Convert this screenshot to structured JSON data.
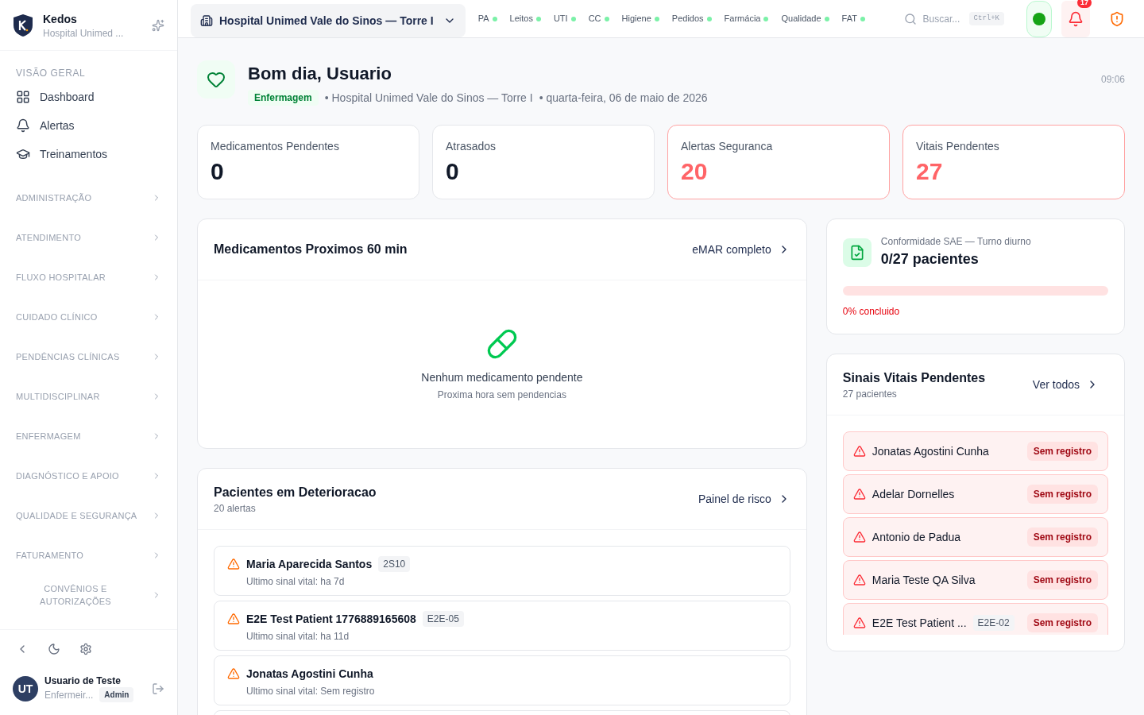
{
  "brand": {
    "name": "Kedos",
    "subtitle": "Hospital Unimed ..."
  },
  "sidebar": {
    "section_title": "VISÃO GERAL",
    "items": [
      {
        "label": "Dashboard",
        "selected": false
      },
      {
        "label": "Alertas",
        "selected": false
      },
      {
        "label": "Treinamentos",
        "selected": false
      }
    ],
    "groups": [
      {
        "label": "ADMINISTRAÇÃO",
        "expanded": false
      },
      {
        "label": "ATENDIMENTO",
        "expanded": false
      },
      {
        "label": "FLUXO HOSPITALAR",
        "expanded": false
      },
      {
        "label": "CUIDADO CLÍNICO",
        "expanded": false
      },
      {
        "label": "PENDÊNCIAS CLÍNICAS",
        "expanded": false
      },
      {
        "label": "MULTIDISCIPLINAR",
        "expanded": false
      },
      {
        "label": "ENFERMAGEM",
        "expanded": false
      },
      {
        "label": "DIAGNÓSTICO E APOIO",
        "expanded": false
      },
      {
        "label": "QUALIDADE E SEGURANÇA",
        "expanded": false
      },
      {
        "label": "FATURAMENTO",
        "expanded": false
      },
      {
        "label": "CONVÊNIOS E AUTORIZAÇÕES",
        "expanded": false
      }
    ],
    "user": {
      "initials": "UT",
      "name": "Usuario de Teste",
      "role": "Enfermeir...",
      "badge": "Admin"
    }
  },
  "topbar": {
    "unit": "Hospital Unimed Vale do Sinos — Torre I",
    "links": [
      {
        "label": "PA"
      },
      {
        "label": "Leitos"
      },
      {
        "label": "UTI"
      },
      {
        "label": "CC"
      },
      {
        "label": "Higiene"
      },
      {
        "label": "Pedidos"
      },
      {
        "label": "Farmácia"
      },
      {
        "label": "Qualidade"
      },
      {
        "label": "FAT"
      }
    ],
    "search": {
      "placeholder": "Buscar...",
      "shortcut": "Ctrl+K"
    },
    "notifications": "17"
  },
  "header": {
    "greeting": "Bom dia, Usuario",
    "role": "Enfermagem",
    "unit": "• Hospital Unimed Vale do Sinos — Torre I",
    "date": "• quarta-feira, 06 de maio de 2026",
    "time": "09:06"
  },
  "stats": [
    {
      "label": "Medicamentos Pendentes",
      "value": "0",
      "alert": false
    },
    {
      "label": "Atrasados",
      "value": "0",
      "alert": false
    },
    {
      "label": "Alertas Seguranca",
      "value": "20",
      "alert": true
    },
    {
      "label": "Vitais Pendentes",
      "value": "27",
      "alert": true
    }
  ],
  "meds": {
    "title": "Medicamentos Proximos 60 min",
    "link": "eMAR completo",
    "empty_title": "Nenhum medicamento pendente",
    "empty_subtitle": "Proxima hora sem pendencias"
  },
  "deterioration": {
    "title": "Pacientes em Deterioracao",
    "subtitle": "20 alertas",
    "link": "Painel de risco",
    "patients": [
      {
        "name": "Maria Aparecida Santos",
        "bed": "2S10",
        "note": "Ultimo sinal vital: ha 7d"
      },
      {
        "name": "E2E Test Patient 1776889165608",
        "bed": "E2E-05",
        "note": "Ultimo sinal vital: ha 11d"
      },
      {
        "name": "Jonatas Agostini Cunha",
        "note": "Ultimo sinal vital: Sem registro"
      }
    ]
  },
  "sae": {
    "title": "Conformidade SAE — Turno diurno",
    "value": "0/27 pacientes",
    "level": 0,
    "caption": "0% concluido"
  },
  "vitals": {
    "title": "Sinais Vitais Pendentes",
    "subtitle": "27 pacientes",
    "link": "Ver todos",
    "patients": [
      {
        "name": "Jonatas Agostini Cunha",
        "status": "Sem registro"
      },
      {
        "name": "Adelar Dornelles",
        "status": "Sem registro"
      },
      {
        "name": "Antonio de Padua",
        "status": "Sem registro"
      },
      {
        "name": "Maria Teste QA Silva",
        "status": "Sem registro"
      },
      {
        "name": "E2E Test Patient ...",
        "bed": "E2E-02",
        "status": "Sem registro"
      }
    ]
  }
}
